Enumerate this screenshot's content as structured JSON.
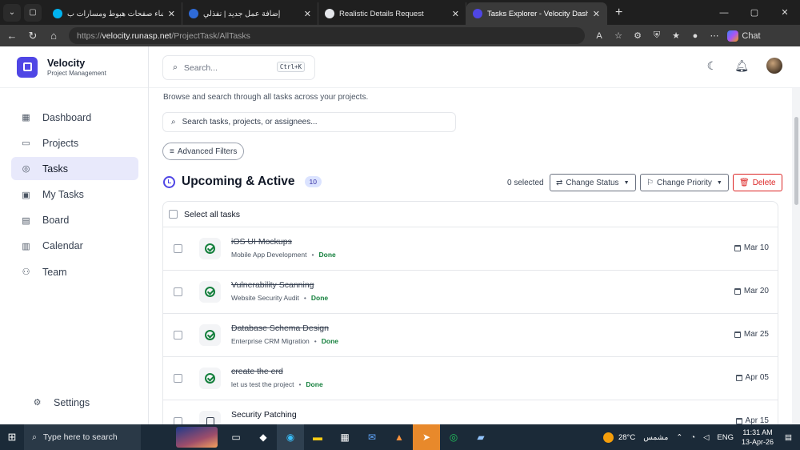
{
  "browser": {
    "tabs": [
      {
        "title": "خبير إنشاء صفحات هبوط ومسارات ب",
        "active": false,
        "fav_color": "#00b3f0"
      },
      {
        "title": "إضافة عمل جديد | نفذلي",
        "active": false,
        "fav_color": "#2f6bd8"
      },
      {
        "title": "Realistic Details Request",
        "active": false,
        "fav_color": "#e5e7eb"
      },
      {
        "title": "Tasks Explorer - Velocity Dashboard",
        "active": true,
        "fav_color": "#4f46e5"
      }
    ],
    "close_glyph": "✕",
    "new_tab_glyph": "+",
    "url_scheme": "https://",
    "url_host": "velocity.runasp.net",
    "url_path": "/ProjectTask/AllTasks",
    "chat_label": "Chat"
  },
  "sidebar": {
    "brand_name": "Velocity",
    "brand_sub": "Project Management",
    "items": [
      {
        "label": "Dashboard",
        "icon": "grid-icon",
        "glyph": "▦",
        "active": false
      },
      {
        "label": "Projects",
        "icon": "folder-icon",
        "glyph": "▭",
        "active": false
      },
      {
        "label": "Tasks",
        "icon": "check-circle-icon",
        "glyph": "◎",
        "active": true
      },
      {
        "label": "My Tasks",
        "icon": "user-card-icon",
        "glyph": "▣",
        "active": false
      },
      {
        "label": "Board",
        "icon": "board-icon",
        "glyph": "▤",
        "active": false
      },
      {
        "label": "Calendar",
        "icon": "calendar-icon",
        "glyph": "▥",
        "active": false
      },
      {
        "label": "Team",
        "icon": "team-icon",
        "glyph": "⚇",
        "active": false
      }
    ],
    "settings_label": "Settings"
  },
  "topbar": {
    "search_placeholder": "Search...",
    "search_shortcut": "Ctrl+K"
  },
  "main": {
    "subtitle": "Browse and search through all tasks across your projects.",
    "task_search_placeholder": "Search tasks, projects, or assignees...",
    "advanced_filters_label": "Advanced Filters",
    "section_title": "Upcoming & Active",
    "section_count": "10",
    "selected_text": "0 selected",
    "change_status_label": "Change Status",
    "change_priority_label": "Change Priority",
    "delete_label": "Delete",
    "select_all_label": "Select all tasks",
    "meta_separator": "•",
    "tasks": [
      {
        "title": "iOS UI Mockups",
        "project": "Mobile App Development",
        "status": "Done",
        "date": "Mar 10",
        "done": true
      },
      {
        "title": "Vulnerability Scanning",
        "project": "Website Security Audit",
        "status": "Done",
        "date": "Mar 20",
        "done": true
      },
      {
        "title": "Database Schema Design",
        "project": "Enterprise CRM Migration",
        "status": "Done",
        "date": "Mar 25",
        "done": true
      },
      {
        "title": "create the erd",
        "project": "let us test the project",
        "status": "Done",
        "date": "Apr 05",
        "done": true
      },
      {
        "title": "Security Patching",
        "project": "",
        "status": "",
        "date": "Apr 15",
        "done": false
      }
    ]
  },
  "taskbar": {
    "search_text": "Type here to search",
    "temperature": "28°C",
    "weather_text": "مشمس",
    "language": "ENG",
    "time": "11:31 AM",
    "date": "13-Apr-26"
  }
}
